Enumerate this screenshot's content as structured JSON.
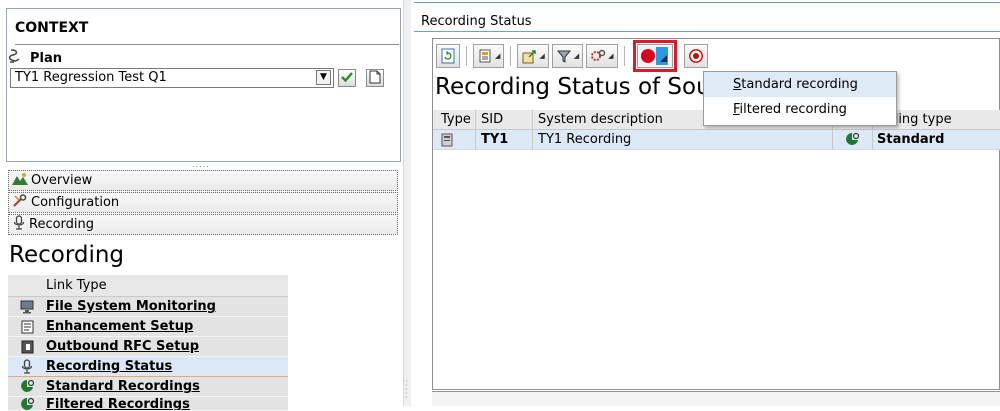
{
  "context": {
    "title": "CONTEXT",
    "plan_label": "Plan",
    "plan_value": "TY1 Regression Test Q1",
    "plan_icon": "plan-link-icon"
  },
  "nav": {
    "items": [
      {
        "label": "Overview",
        "icon": "overview-mountain-icon"
      },
      {
        "label": "Configuration",
        "icon": "wrench-icon"
      },
      {
        "label": "Recording",
        "icon": "microphone-icon"
      }
    ]
  },
  "recording_section": {
    "title": "Recording",
    "column_header": "Link Type",
    "links": [
      {
        "label": "File System Monitoring",
        "icon": "monitor-icon"
      },
      {
        "label": "Enhancement Setup",
        "icon": "document-icon"
      },
      {
        "label": "Outbound RFC Setup",
        "icon": "outbound-icon"
      },
      {
        "label": "Recording Status",
        "icon": "microphone-icon"
      },
      {
        "label": "Standard Recordings",
        "icon": "standard-recording-icon"
      },
      {
        "label": "Filtered Recordings",
        "icon": "filtered-recording-icon"
      }
    ]
  },
  "panel": {
    "tab_title": "Recording Status",
    "heading": "Recording Status of Sourc",
    "toolbar": [
      "refresh-icon",
      "layout-icon",
      "export-icon",
      "filter-icon",
      "settings-icon",
      "record-dropdown-icon",
      "record-target-icon"
    ]
  },
  "grid": {
    "headers": {
      "type": "Type",
      "sid": "SID",
      "desc": "System description",
      "icon": "",
      "rtype": "ording type"
    },
    "rows": [
      {
        "type_icon": "system-icon",
        "sid": "TY1",
        "desc": "TY1 Recording",
        "status_icon": "standard-recording-icon",
        "rtype": "Standard"
      }
    ]
  },
  "menu": {
    "items": [
      {
        "label": "Standard recording",
        "accel": "S",
        "rest": "tandard recording"
      },
      {
        "label": "Filtered recording",
        "accel": "F",
        "rest": "iltered recording"
      }
    ]
  },
  "colors": {
    "highlight_border": "#e0182b",
    "record_red": "#d9001b",
    "selection": "#dde9f7"
  }
}
